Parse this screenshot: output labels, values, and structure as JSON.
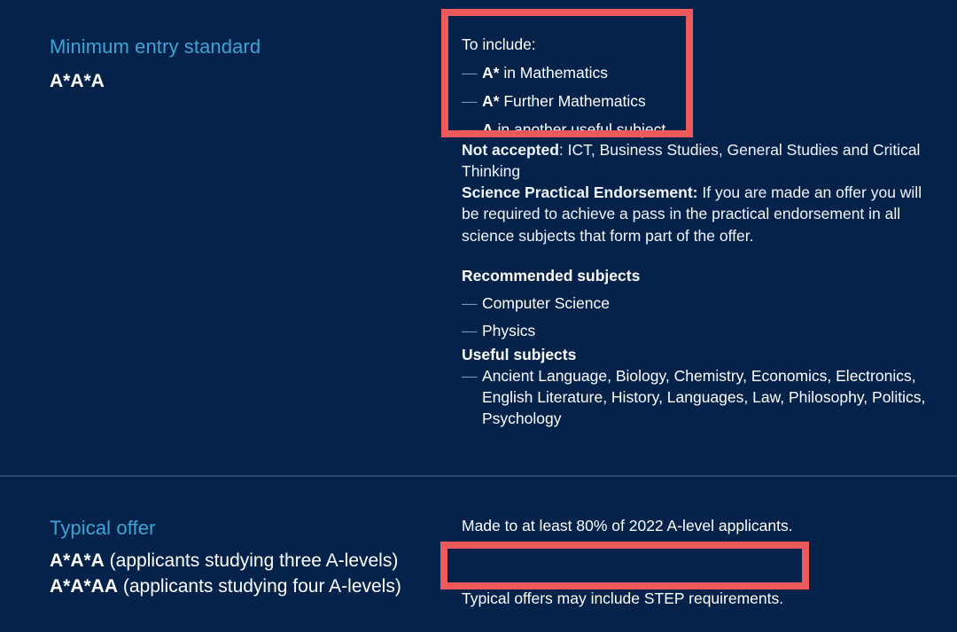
{
  "theme": {
    "background": "#04224a",
    "heading_color": "#3ea3d6",
    "text_color": "#ffffff",
    "highlight_border": "#ee5a5c",
    "dash_color": "#7e93ac",
    "divider_color": "#2a4a72"
  },
  "sections": {
    "minimum_entry_standard": {
      "heading": "Minimum entry standard",
      "grade": "A*A*A",
      "to_include": {
        "label": "To include:",
        "items": [
          {
            "grade": "A*",
            "text": " in Mathematics"
          },
          {
            "grade": "A*",
            "text": " Further Mathematics"
          },
          {
            "grade": "A",
            "text": " in another useful subject"
          }
        ]
      },
      "not_accepted": {
        "label": "Not accepted",
        "text": ": ICT, Business Studies, General Studies and Critical Thinking"
      },
      "science_practical_endorsement": {
        "label": "Science Practical Endorsement:",
        "text": " If you are made an offer you will be required to achieve a pass in the practical endorsement in all science subjects that form part of the offer."
      },
      "recommended_subjects": {
        "heading": "Recommended subjects",
        "items": [
          "Computer Science",
          "Physics"
        ]
      },
      "useful_subjects": {
        "heading": "Useful subjects",
        "items": [
          "Ancient Language, Biology, Chemistry, Economics, Electronics, English Literature, History, Languages, Law, Philosophy, Politics, Psychology"
        ]
      }
    },
    "typical_offer": {
      "heading": "Typical offer",
      "grades": [
        {
          "grade": "A*A*A",
          "qualifier": " (applicants studying three A-levels)"
        },
        {
          "grade": "A*A*AA",
          "qualifier": " (applicants studying four A-levels)"
        }
      ],
      "note": "Made to at least 80% of 2022 A-level applicants.",
      "step_note": "Typical offers may include STEP requirements."
    }
  },
  "annotations": {
    "highlight_top": "to-include-requirements",
    "highlight_bottom": "step-requirements-note"
  },
  "glyphs": {
    "dash": "—"
  }
}
